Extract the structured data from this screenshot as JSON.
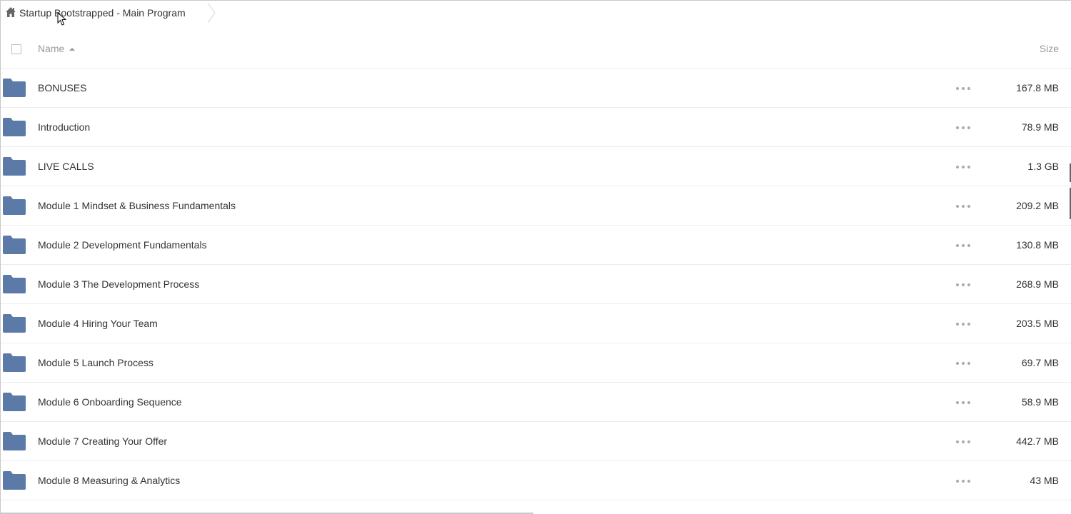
{
  "breadcrumb": {
    "home_icon": "home-icon",
    "label": "Startup Bootstrapped - Main Program"
  },
  "header": {
    "name_label": "Name",
    "size_label": "Size",
    "sort": "ascending"
  },
  "colors": {
    "folder": "#5b7aa8",
    "text": "#333333",
    "muted": "#999999"
  },
  "rows": [
    {
      "name": "BONUSES",
      "size": "167.8 MB"
    },
    {
      "name": "Introduction",
      "size": "78.9 MB"
    },
    {
      "name": "LIVE CALLS",
      "size": "1.3 GB"
    },
    {
      "name": "Module 1 Mindset & Business Fundamentals",
      "size": "209.2 MB"
    },
    {
      "name": "Module 2 Development Fundamentals",
      "size": "130.8 MB"
    },
    {
      "name": "Module 3 The Development Process",
      "size": "268.9 MB"
    },
    {
      "name": "Module 4 Hiring Your Team",
      "size": "203.5 MB"
    },
    {
      "name": "Module 5 Launch Process",
      "size": "69.7 MB"
    },
    {
      "name": "Module 6 Onboarding Sequence",
      "size": "58.9 MB"
    },
    {
      "name": "Module 7 Creating Your Offer",
      "size": "442.7 MB"
    },
    {
      "name": "Module 8 Measuring & Analytics",
      "size": "43 MB"
    }
  ]
}
